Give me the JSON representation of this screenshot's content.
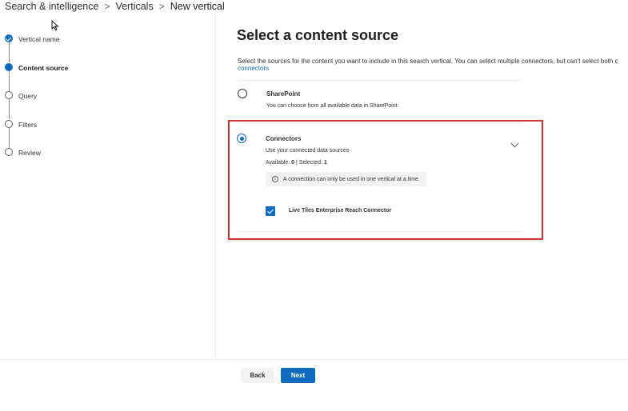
{
  "breadcrumb": {
    "items": [
      "Search & intelligence",
      "Verticals"
    ],
    "current": "New vertical",
    "separator": ">"
  },
  "stepper": {
    "steps": [
      {
        "label": "Vertical name",
        "state": "done"
      },
      {
        "label": "Content source",
        "state": "current"
      },
      {
        "label": "Query",
        "state": "todo"
      },
      {
        "label": "Filters",
        "state": "todo"
      },
      {
        "label": "Review",
        "state": "todo"
      }
    ]
  },
  "main": {
    "title": "Select a content source",
    "description": "Select the sources for the content you want to include in this search vertical. You can select multiple connectors, but can't select both c",
    "link": "connectors",
    "options": {
      "sharepoint": {
        "title": "SharePoint",
        "text": "You can choose from all available data in SharePoint.",
        "selected": false
      },
      "connectors": {
        "title": "Connectors",
        "text": "Use your connected data sources",
        "available_label": "Available: ",
        "available_value": "0",
        "divider": " | ",
        "selected_label": "Selected: ",
        "selected_value": "1",
        "selected": true,
        "info": "A connection can only be used in one vertical at a time.",
        "items": [
          {
            "label": "Live Tiles Enterprise Reach Connector",
            "checked": true
          }
        ]
      }
    }
  },
  "footer": {
    "back_label": "Back",
    "next_label": "Next"
  },
  "colors": {
    "accent": "#0f6cbd",
    "highlight": "#d13438"
  },
  "icons": {
    "step_done": "checkmark-circle-icon",
    "info": "info-icon",
    "chevron": "chevron-down-icon",
    "checkbox": "checkmark-icon"
  }
}
